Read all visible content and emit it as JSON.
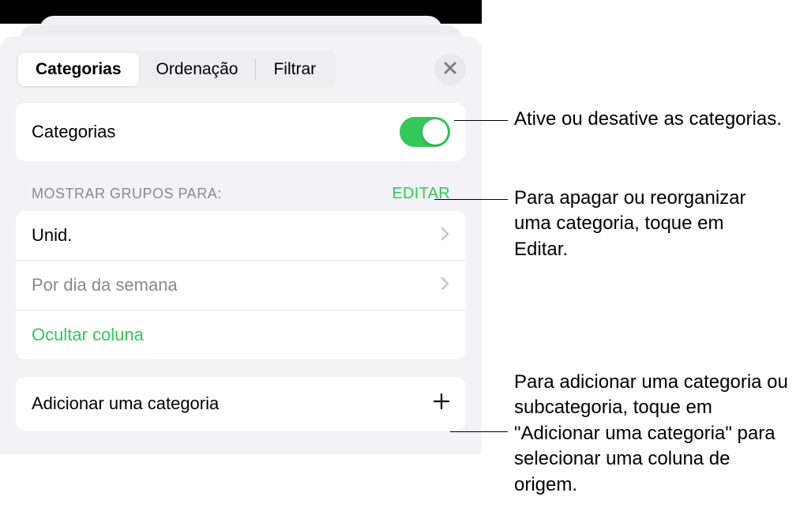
{
  "tabs": {
    "categorias": "Categorias",
    "ordenacao": "Ordenação",
    "filtrar": "Filtrar"
  },
  "toggleRow": {
    "label": "Categorias"
  },
  "section": {
    "header": "MOSTRAR GRUPOS PARA:",
    "edit": "EDITAR",
    "items": {
      "unid": "Unid.",
      "pordia": "Por dia da semana",
      "ocultar": "Ocultar coluna"
    }
  },
  "addRow": {
    "label": "Adicionar uma categoria"
  },
  "callouts": {
    "toggle": "Ative ou desative as categorias.",
    "edit": "Para apagar ou reorganizar uma categoria, toque em Editar.",
    "add": "Para adicionar uma categoria ou subcategoria, toque em \"Adicionar uma categoria\" para selecionar uma coluna de origem."
  }
}
